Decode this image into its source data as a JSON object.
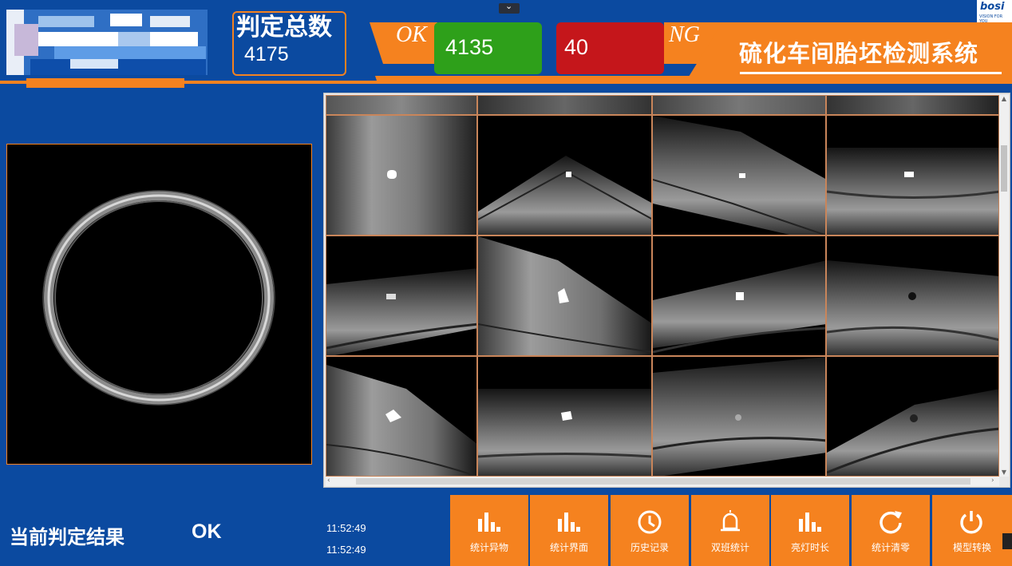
{
  "header": {
    "total_label": "判定总数",
    "total_value": "4175",
    "ok_label": "OK",
    "ok_count": "4135",
    "ng_label": "NG",
    "ng_count": "40",
    "system_title": "硫化车间胎坯检测系统",
    "brand_name": "bosi",
    "brand_tagline": "VISION FOR YOU",
    "collapse_icon": "chevron-down-icon"
  },
  "colors": {
    "background": "#0b4aa0",
    "accent": "#f5821f",
    "ok": "#2ea01a",
    "ng": "#c5161b"
  },
  "result": {
    "label": "当前判定结果",
    "value": "OK",
    "times": [
      "11:52:49",
      "11:52:49"
    ]
  },
  "toolbar": [
    {
      "label": "统计异物",
      "icon": "bar-chart-icon"
    },
    {
      "label": "统计界面",
      "icon": "bar-chart-icon"
    },
    {
      "label": "历史记录",
      "icon": "clock-icon"
    },
    {
      "label": "双班统计",
      "icon": "bell-icon"
    },
    {
      "label": "亮灯时长",
      "icon": "bar-chart-icon"
    },
    {
      "label": "统计清零",
      "icon": "refresh-icon"
    },
    {
      "label": "模型转换",
      "icon": "power-icon"
    }
  ]
}
